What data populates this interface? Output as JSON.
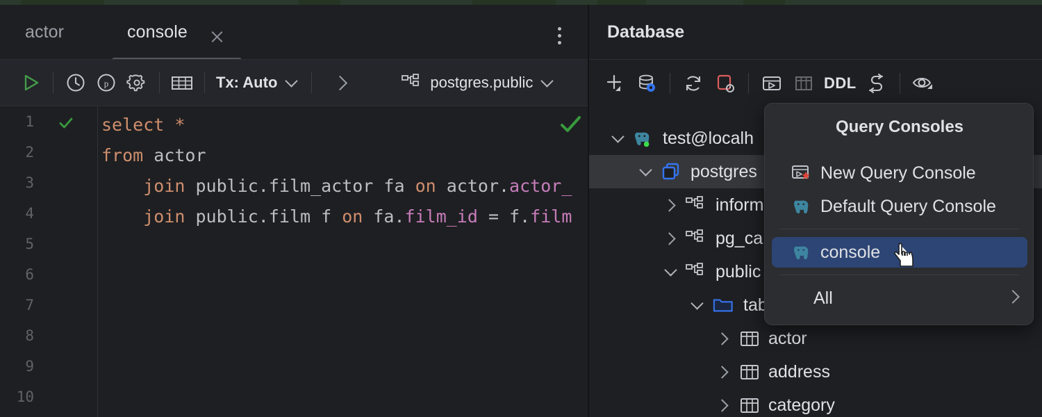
{
  "window": {
    "app": "DataGrip-like SQL IDE"
  },
  "editor": {
    "tabs": [
      {
        "label": "actor",
        "active": false
      },
      {
        "label": "console",
        "active": true
      }
    ],
    "close_icon": "close-icon",
    "overflow_menu_icon": "more-vertical-icon",
    "toolbar": {
      "run_icon": "play-icon",
      "history_icon": "clock-icon",
      "params_icon": "circled-p-icon",
      "settings_icon": "gear-icon",
      "grid_icon": "table-grid-icon",
      "tx_label": "Tx: Auto",
      "tx_dropdown_icon": "chevron-down-icon",
      "step_icon": "chevron-right-icon",
      "schema_icon": "schema-icon",
      "schema_label": "postgres.public",
      "schema_dropdown_icon": "chevron-down-icon"
    },
    "gutter": {
      "line_numbers": [
        "1",
        "2",
        "3",
        "4",
        "5",
        "6",
        "7",
        "8",
        "9",
        "10"
      ],
      "line1_status_icon": "green-check-icon"
    },
    "inspection_icon": "green-check-icon",
    "code_lines": [
      {
        "n": 1,
        "tokens": [
          {
            "t": "select",
            "c": "kw"
          },
          {
            "t": " ",
            "c": "op"
          },
          {
            "t": "*",
            "c": "star"
          }
        ]
      },
      {
        "n": 2,
        "tokens": [
          {
            "t": "from",
            "c": "kw"
          },
          {
            "t": " actor",
            "c": "id"
          }
        ]
      },
      {
        "n": 3,
        "tokens": [
          {
            "t": "    ",
            "c": "op"
          },
          {
            "t": "join",
            "c": "kw"
          },
          {
            "t": " public.film_actor fa ",
            "c": "id"
          },
          {
            "t": "on",
            "c": "kw"
          },
          {
            "t": " actor.",
            "c": "id"
          },
          {
            "t": "actor_",
            "c": "col"
          }
        ]
      },
      {
        "n": 4,
        "tokens": [
          {
            "t": "    ",
            "c": "op"
          },
          {
            "t": "join",
            "c": "kw"
          },
          {
            "t": " public.film f ",
            "c": "id"
          },
          {
            "t": "on",
            "c": "kw"
          },
          {
            "t": " fa.",
            "c": "id"
          },
          {
            "t": "film_id",
            "c": "col"
          },
          {
            "t": " = ",
            "c": "op"
          },
          {
            "t": "f.",
            "c": "id"
          },
          {
            "t": "film",
            "c": "col"
          }
        ]
      },
      {
        "n": 5,
        "tokens": []
      },
      {
        "n": 6,
        "tokens": []
      },
      {
        "n": 7,
        "tokens": []
      },
      {
        "n": 8,
        "tokens": []
      },
      {
        "n": 9,
        "tokens": []
      },
      {
        "n": 10,
        "tokens": []
      }
    ],
    "code_plain": "select *\nfrom actor\n    join public.film_actor fa on actor.actor_\n    join public.film f on fa.film_id = f.film"
  },
  "database_panel": {
    "title": "Database",
    "toolbar": {
      "add_icon": "plus-with-dropdown-icon",
      "datasource_properties_icon": "database-settings-icon",
      "refresh_icon": "refresh-icon",
      "stop_icon": "stop-red-icon",
      "query_console_icon": "query-console-icon",
      "data_editor_icon": "table-grid-icon",
      "ddl_label": "DDL",
      "sync_icon": "jump-to-icon",
      "preview_icon": "eye-with-dropdown-icon"
    },
    "tree": [
      {
        "label": "test@localh",
        "icon": "postgres-elephant-icon",
        "state": "expanded",
        "indent": 0,
        "selected": false,
        "status": "connected"
      },
      {
        "label": "postgres",
        "icon": "database-icon",
        "state": "expanded",
        "indent": 1,
        "selected": true
      },
      {
        "label": "inform",
        "icon": "schema-icon",
        "state": "collapsed",
        "indent": 2,
        "selected": false
      },
      {
        "label": "pg_ca",
        "icon": "schema-icon",
        "state": "collapsed",
        "indent": 2,
        "selected": false
      },
      {
        "label": "public",
        "icon": "schema-icon",
        "state": "expanded",
        "indent": 2,
        "selected": false
      },
      {
        "label": "tab",
        "icon": "folder-icon",
        "state": "expanded",
        "indent": 3,
        "selected": false
      },
      {
        "label": "actor",
        "icon": "table-icon",
        "state": "collapsed",
        "indent": 4,
        "selected": false
      },
      {
        "label": "address",
        "icon": "table-icon",
        "state": "collapsed",
        "indent": 4,
        "selected": false
      },
      {
        "label": "category",
        "icon": "table-icon",
        "state": "collapsed",
        "indent": 4,
        "selected": false
      }
    ]
  },
  "popup": {
    "title": "Query Consoles",
    "items": [
      {
        "label": "New Query Console",
        "icon": "new-query-console-icon",
        "highlighted": false
      },
      {
        "label": "Default Query Console",
        "icon": "postgres-elephant-icon",
        "highlighted": false
      },
      {
        "label": "console",
        "icon": "postgres-elephant-icon",
        "highlighted": true
      }
    ],
    "submenu": {
      "label": "All",
      "arrow_icon": "chevron-right-icon"
    },
    "cursor_icon": "pointer-hand-cursor"
  },
  "colors": {
    "background": "#1e1f22",
    "toolbar_bg": "#24262b",
    "popup_bg": "#2b2d30",
    "highlight_blue": "#2d4574",
    "selection_gray": "#35373b",
    "accent_green": "#459c4a",
    "accent_blue": "#3574F0",
    "accent_red": "#DB5C5C",
    "keyword": "#CF8E6D",
    "column": "#C77DBB",
    "identifier": "#bcbec4",
    "text": "#dfe1e5"
  }
}
